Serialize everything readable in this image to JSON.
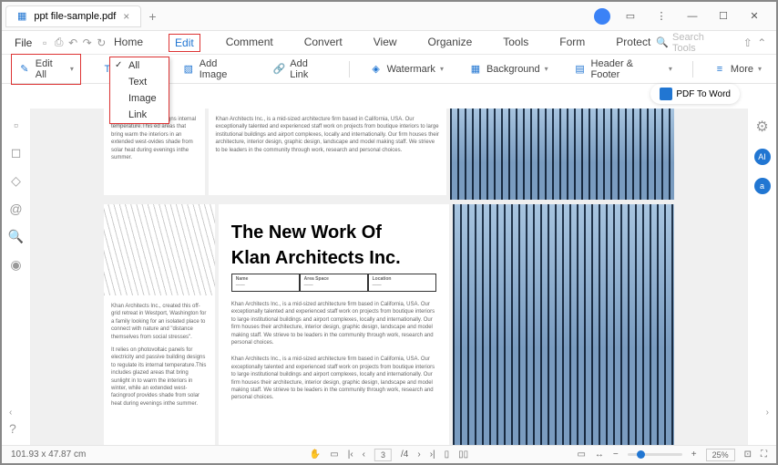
{
  "tab": {
    "title": "ppt file-sample.pdf"
  },
  "file_menu": {
    "label": "File"
  },
  "menubar": {
    "items": [
      "Home",
      "Edit",
      "Comment",
      "Convert",
      "View",
      "Organize",
      "Tools",
      "Form",
      "Protect"
    ],
    "active": "Edit",
    "search_placeholder": "Search Tools"
  },
  "ribbon": {
    "edit_all": "Edit All",
    "add_text": "Add Text",
    "add_image": "Add Image",
    "add_link": "Add Link",
    "watermark": "Watermark",
    "background": "Background",
    "header_footer": "Header & Footer",
    "more": "More"
  },
  "dropdown": {
    "items": [
      {
        "label": "All",
        "checked": true
      },
      {
        "label": "Text",
        "checked": false
      },
      {
        "label": "Image",
        "checked": false
      },
      {
        "label": "Link",
        "checked": false
      }
    ]
  },
  "pdf_to_word": {
    "label": "PDF To Word"
  },
  "doc": {
    "headline1": "The New Work Of",
    "headline2": "Klan Architects Inc.",
    "table": {
      "c1": "Name",
      "c2": "Area Space",
      "c3": "Location"
    },
    "para": "Khan Architects Inc., is a mid-sized architecture firm based in California, USA. Our exceptionally talented and experienced staff work on projects from boutique interiors to large institutional buildings and airport complexes, locally and internationally. Our firm houses their architecture, interior design, graphic design, landscape and model making staff. We strieve to be leaders in the community through work, research and personal choices.",
    "para_left1": "Khan Architects Inc., created this off-grid retreat in Westport, Washington for a family looking for an isolated place to connect with nature and \"distance themselves from social stresses\".",
    "para_left2": "It relies on photovoltaic panels for electricity and passive building designs to regulate its internal temperature.This includes glazed areas that bring sunlight in to warm the interiors in winter, while an extended west-facingroof provides shade from solar heat during evenings inthe summer.",
    "frag": "of passive building designs internal temperature.This ed areas that bring warm the interiors in an extended west-ovides shade from solar heat during evenings inthe summer."
  },
  "status": {
    "dims": "101.93 x 47.87 cm",
    "page_current": "3",
    "page_total": "/4",
    "zoom": "25%"
  }
}
